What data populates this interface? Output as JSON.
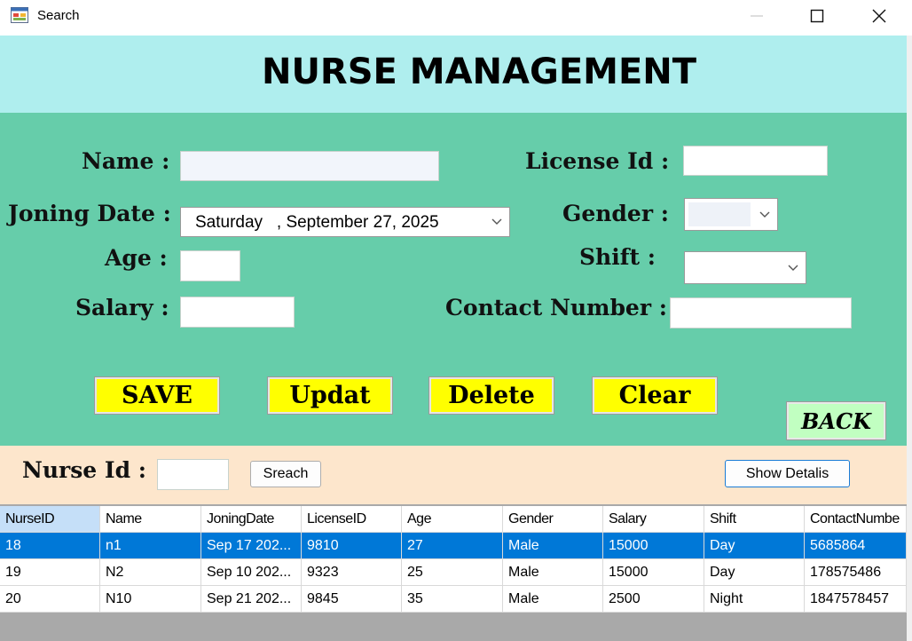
{
  "window": {
    "title": "Search",
    "icons": {
      "app": "app-form-icon",
      "minimize": "minimize-icon",
      "maximize": "maximize-icon",
      "close": "close-icon"
    }
  },
  "header": {
    "title": "NURSE MANAGEMENT"
  },
  "form": {
    "name_label": "Name :",
    "name_value": "",
    "license_label": "License Id :",
    "license_value": "",
    "joining_label": "Joning Date :",
    "joining_value": "Saturday   , September 27, 2025",
    "gender_label": "Gender :",
    "gender_value": "",
    "age_label": "Age :",
    "age_value": "",
    "shift_label": "Shift :",
    "shift_value": "",
    "salary_label": "Salary :",
    "salary_value": "",
    "contact_label": "Contact Number :",
    "contact_value": ""
  },
  "actions": {
    "save": "SAVE",
    "update": "Updat",
    "delete": "Delete",
    "clear": "Clear",
    "back": "BACK"
  },
  "search": {
    "nurse_id_label": "Nurse Id :",
    "nurse_id_value": "",
    "search_button": "Sreach",
    "show_details_button": "Show Detalis"
  },
  "table": {
    "columns": [
      "NurseID",
      "Name",
      "JoningDate",
      "LicenseID",
      "Age",
      "Gender",
      "Salary",
      "Shift",
      "ContactNumbe"
    ],
    "rows": [
      [
        "18",
        "n1",
        "Sep 17 202...",
        "9810",
        "27",
        "Male",
        "15000",
        "Day",
        "5685864"
      ],
      [
        "19",
        "N2",
        "Sep 10 202...",
        "9323",
        "25",
        "Male",
        "15000",
        "Day",
        "178575486"
      ],
      [
        "20",
        "N10",
        "Sep 21 202...",
        "9845",
        "35",
        "Male",
        "2500",
        "Night",
        "1847578457"
      ]
    ],
    "selected_row": 0
  },
  "colors": {
    "header_bg": "#afeeee",
    "form_bg": "#66cdaa",
    "search_bg": "#fde6cc",
    "action_button_bg": "#ffff00",
    "back_button_bg": "#c1ffc1",
    "selection": "#0078d7"
  }
}
